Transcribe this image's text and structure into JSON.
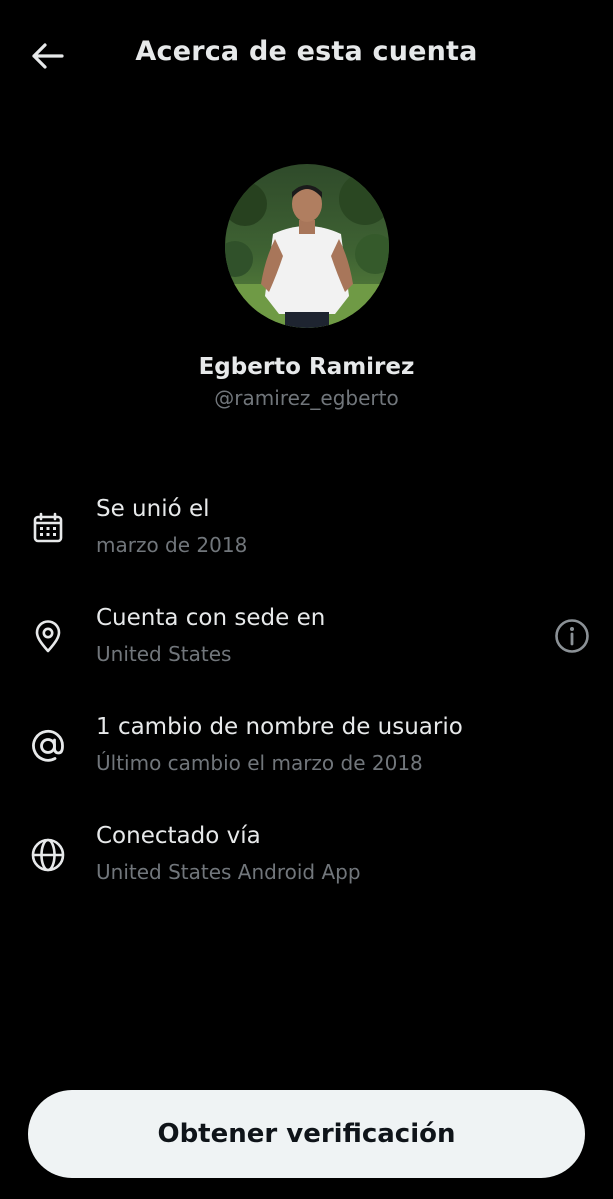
{
  "header": {
    "title": "Acerca de esta cuenta",
    "back_icon": "arrow-left-icon"
  },
  "profile": {
    "name": "Egberto Ramirez",
    "handle": "@ramirez_egberto",
    "avatar_alt": "profile photo"
  },
  "info": [
    {
      "icon": "calendar-icon",
      "title": "Se unió el",
      "subtitle": "marzo de 2018"
    },
    {
      "icon": "location-pin-icon",
      "title": "Cuenta con sede en",
      "subtitle": "United States",
      "action_icon": "info-icon"
    },
    {
      "icon": "at-sign-icon",
      "title": "1 cambio de nombre de usuario",
      "subtitle": "Último cambio el marzo de 2018"
    },
    {
      "icon": "globe-icon",
      "title": "Conectado vía",
      "subtitle": "United States Android App"
    }
  ],
  "cta": {
    "label": "Obtener verificación"
  },
  "colors": {
    "background": "#000000",
    "primary_text": "#e7e9ea",
    "secondary_text": "#71767b",
    "button_bg": "#eff3f4",
    "button_text": "#0f1419"
  }
}
